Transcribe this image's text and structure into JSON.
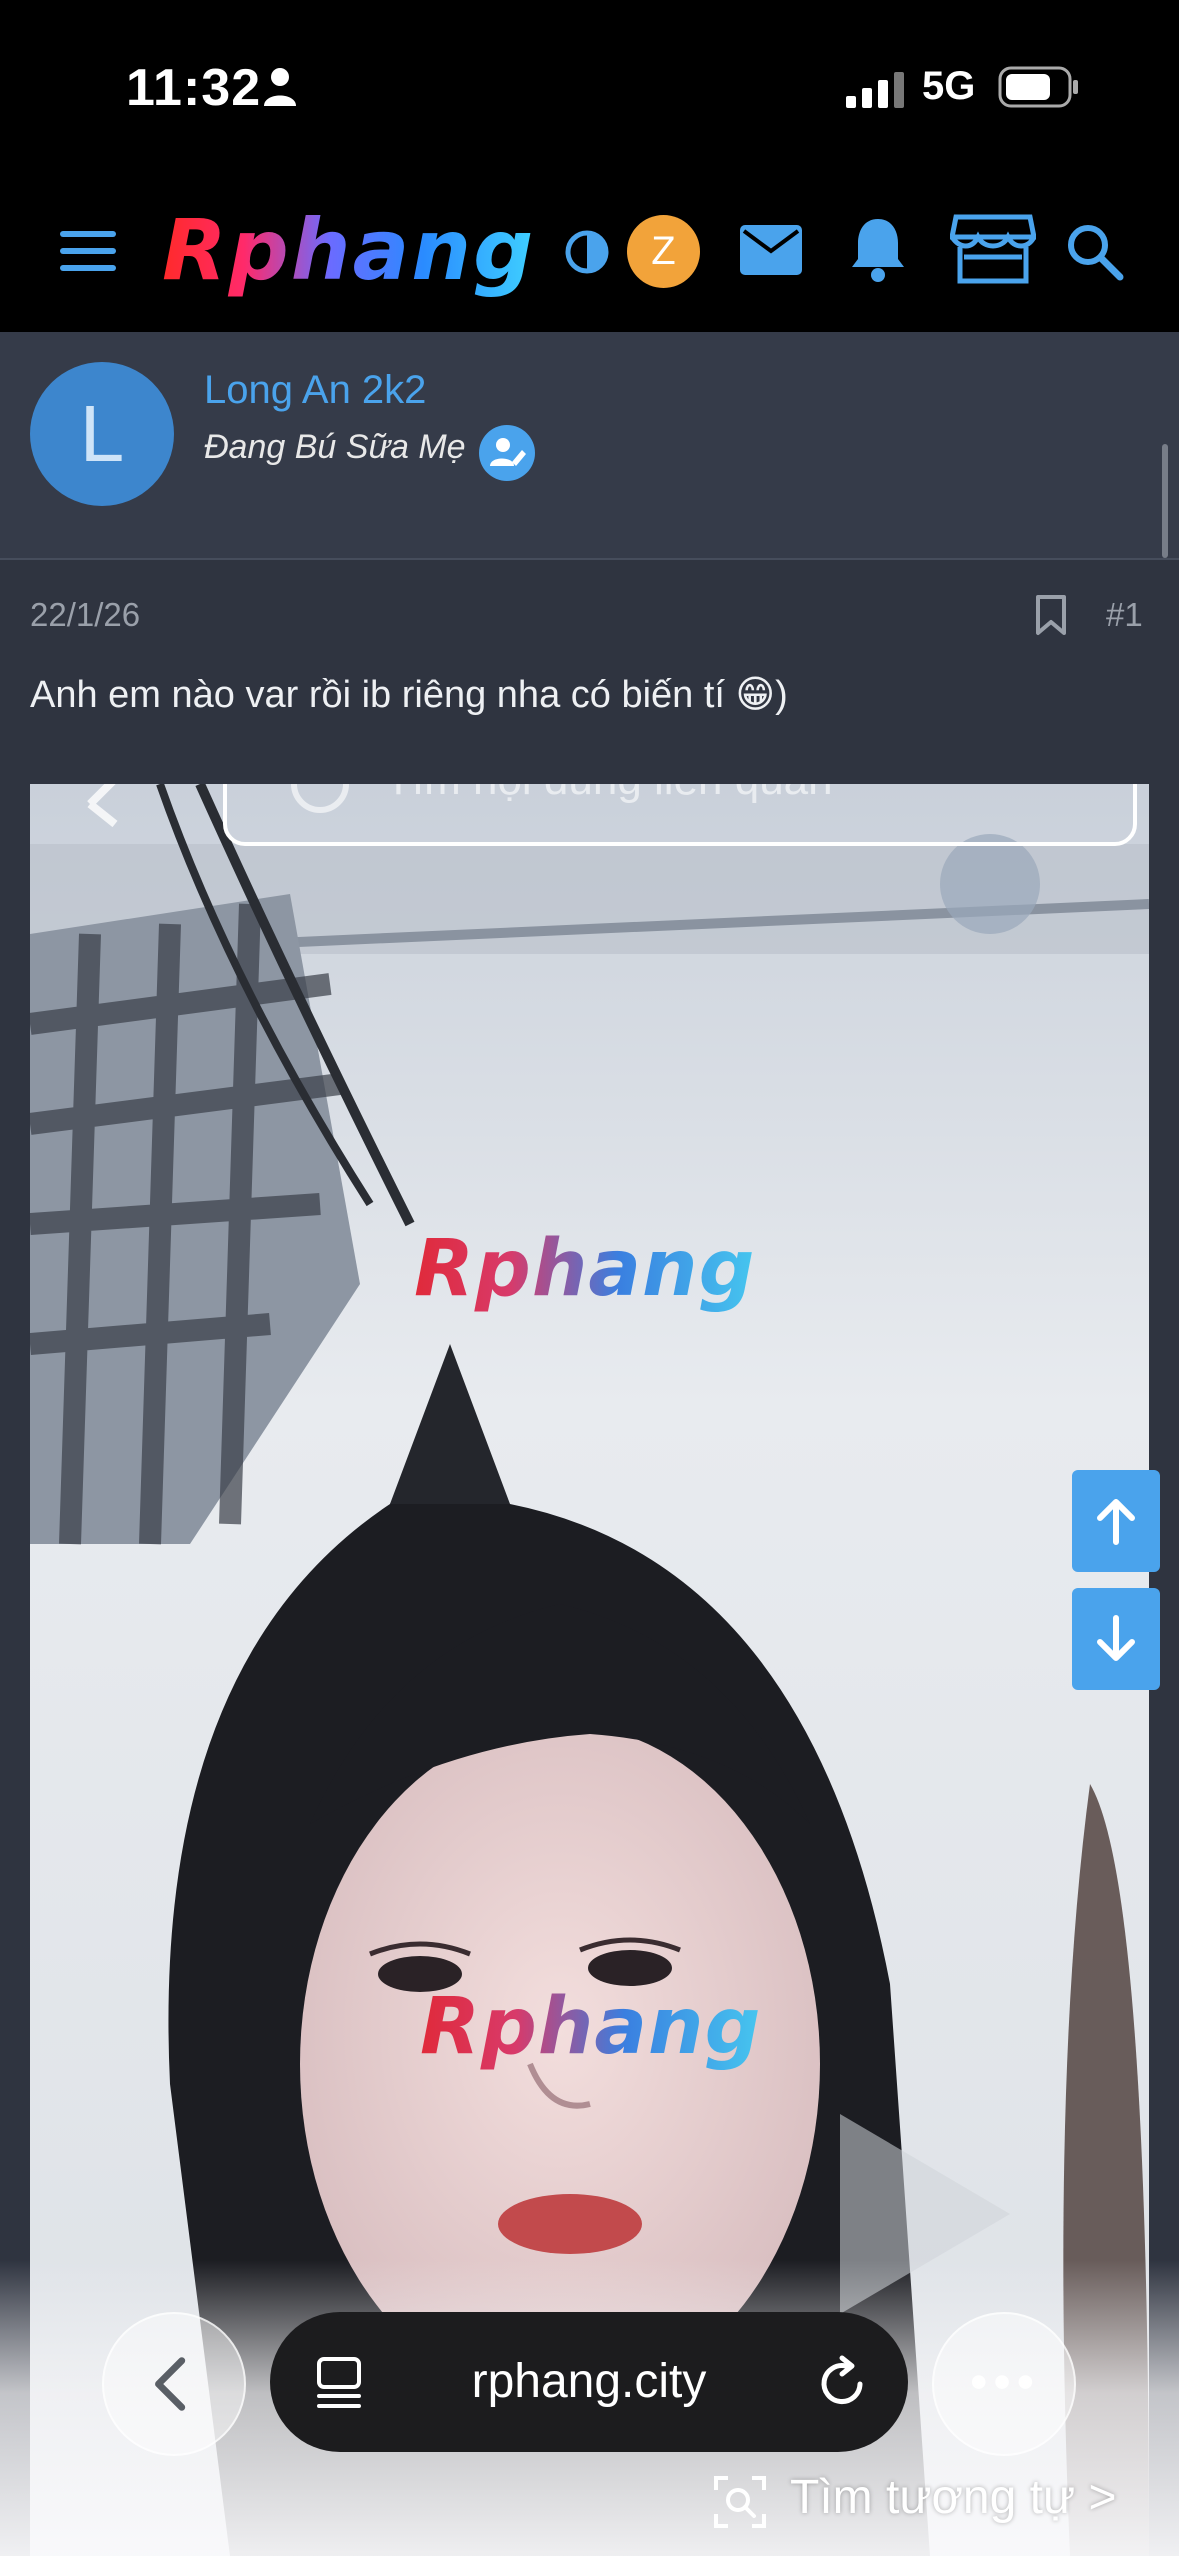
{
  "status_bar": {
    "time": "11:32",
    "network": "5G"
  },
  "header": {
    "logo_text": "Rphang",
    "user_initial": "Z",
    "icons": [
      "menu-icon",
      "theme-toggle-icon",
      "mail-icon",
      "bell-icon",
      "store-icon",
      "search-icon"
    ],
    "accent_color": "#4aa3ec"
  },
  "post": {
    "author_initial": "L",
    "author_name": "Long An 2k2",
    "author_title": "Đang Bú Sữa Mẹ",
    "date": "22/1/26",
    "number": "#1",
    "text": "Anh em nào var rồi ib riêng nha có biến tí 😁)",
    "image_watermark_1": "Rphang",
    "image_watermark_2": "Rphang",
    "image_overlay_text": "Tìm nội dung liên quan"
  },
  "browser": {
    "url": "rphang.city",
    "find_similar": "Tìm tương tự",
    "find_similar_chevron": ">"
  },
  "colors": {
    "header_bg": "#000000",
    "content_bg": "#2f3440",
    "user_block_bg": "#353b49",
    "author_avatar": "#3d86cd",
    "user_badge": "#f2a33a"
  }
}
